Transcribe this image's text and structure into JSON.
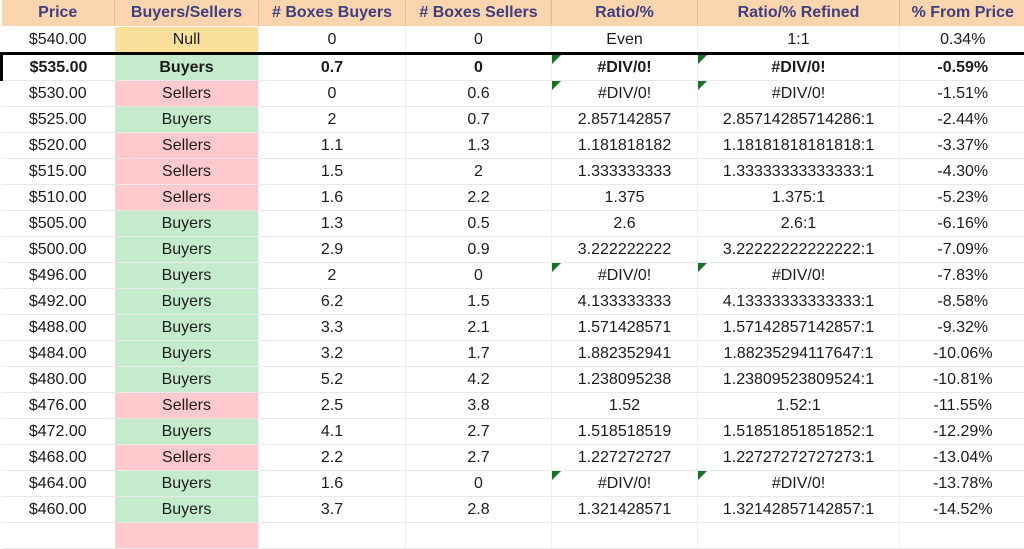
{
  "sheet": {
    "columns": [
      {
        "key": "price",
        "label": "Price"
      },
      {
        "key": "bs",
        "label": "Buyers/Sellers"
      },
      {
        "key": "bb",
        "label": "# Boxes Buyers"
      },
      {
        "key": "bsel",
        "label": "# Boxes Sellers"
      },
      {
        "key": "ratio",
        "label": "Ratio/%"
      },
      {
        "key": "refined",
        "label": "Ratio/% Refined"
      },
      {
        "key": "pct",
        "label": "% From Price"
      }
    ],
    "colors": {
      "header_bg": "#fbd5ae",
      "header_text": "#3f3f7f",
      "buyers_bg": "#c5ebcd",
      "buyers_text": "#1c7a29",
      "sellers_bg": "#ffc9cd",
      "sellers_text": "#c62338",
      "null_bg": "#fbe09b",
      "null_text": "#9a6d1c",
      "error_marker": "#1b7226",
      "selection_border": "#000000"
    },
    "rows": [
      {
        "price": "$540.00",
        "bs": "Null",
        "status": "null",
        "bb": "0",
        "bsel": "0",
        "ratio": "Even",
        "refined": "1:1",
        "pct": "0.34%",
        "ratio_error": false,
        "refined_error": false,
        "selected": false
      },
      {
        "price": "$535.00",
        "bs": "Buyers",
        "status": "buyers",
        "bb": "0.7",
        "bsel": "0",
        "ratio": "#DIV/0!",
        "refined": "#DIV/0!",
        "pct": "-0.59%",
        "ratio_error": true,
        "refined_error": true,
        "selected": true
      },
      {
        "price": "$530.00",
        "bs": "Sellers",
        "status": "sellers",
        "bb": "0",
        "bsel": "0.6",
        "ratio": "#DIV/0!",
        "refined": "#DIV/0!",
        "pct": "-1.51%",
        "ratio_error": true,
        "refined_error": true,
        "selected": false
      },
      {
        "price": "$525.00",
        "bs": "Buyers",
        "status": "buyers",
        "bb": "2",
        "bsel": "0.7",
        "ratio": "2.857142857",
        "refined": "2.85714285714286:1",
        "pct": "-2.44%",
        "ratio_error": false,
        "refined_error": false,
        "selected": false
      },
      {
        "price": "$520.00",
        "bs": "Sellers",
        "status": "sellers",
        "bb": "1.1",
        "bsel": "1.3",
        "ratio": "1.181818182",
        "refined": "1.18181818181818:1",
        "pct": "-3.37%",
        "ratio_error": false,
        "refined_error": false,
        "selected": false
      },
      {
        "price": "$515.00",
        "bs": "Sellers",
        "status": "sellers",
        "bb": "1.5",
        "bsel": "2",
        "ratio": "1.333333333",
        "refined": "1.33333333333333:1",
        "pct": "-4.30%",
        "ratio_error": false,
        "refined_error": false,
        "selected": false
      },
      {
        "price": "$510.00",
        "bs": "Sellers",
        "status": "sellers",
        "bb": "1.6",
        "bsel": "2.2",
        "ratio": "1.375",
        "refined": "1.375:1",
        "pct": "-5.23%",
        "ratio_error": false,
        "refined_error": false,
        "selected": false
      },
      {
        "price": "$505.00",
        "bs": "Buyers",
        "status": "buyers",
        "bb": "1.3",
        "bsel": "0.5",
        "ratio": "2.6",
        "refined": "2.6:1",
        "pct": "-6.16%",
        "ratio_error": false,
        "refined_error": false,
        "selected": false
      },
      {
        "price": "$500.00",
        "bs": "Buyers",
        "status": "buyers",
        "bb": "2.9",
        "bsel": "0.9",
        "ratio": "3.222222222",
        "refined": "3.22222222222222:1",
        "pct": "-7.09%",
        "ratio_error": false,
        "refined_error": false,
        "selected": false
      },
      {
        "price": "$496.00",
        "bs": "Buyers",
        "status": "buyers",
        "bb": "2",
        "bsel": "0",
        "ratio": "#DIV/0!",
        "refined": "#DIV/0!",
        "pct": "-7.83%",
        "ratio_error": true,
        "refined_error": true,
        "selected": false
      },
      {
        "price": "$492.00",
        "bs": "Buyers",
        "status": "buyers",
        "bb": "6.2",
        "bsel": "1.5",
        "ratio": "4.133333333",
        "refined": "4.13333333333333:1",
        "pct": "-8.58%",
        "ratio_error": false,
        "refined_error": false,
        "selected": false
      },
      {
        "price": "$488.00",
        "bs": "Buyers",
        "status": "buyers",
        "bb": "3.3",
        "bsel": "2.1",
        "ratio": "1.571428571",
        "refined": "1.57142857142857:1",
        "pct": "-9.32%",
        "ratio_error": false,
        "refined_error": false,
        "selected": false
      },
      {
        "price": "$484.00",
        "bs": "Buyers",
        "status": "buyers",
        "bb": "3.2",
        "bsel": "1.7",
        "ratio": "1.882352941",
        "refined": "1.88235294117647:1",
        "pct": "-10.06%",
        "ratio_error": false,
        "refined_error": false,
        "selected": false
      },
      {
        "price": "$480.00",
        "bs": "Buyers",
        "status": "buyers",
        "bb": "5.2",
        "bsel": "4.2",
        "ratio": "1.238095238",
        "refined": "1.23809523809524:1",
        "pct": "-10.81%",
        "ratio_error": false,
        "refined_error": false,
        "selected": false
      },
      {
        "price": "$476.00",
        "bs": "Sellers",
        "status": "sellers",
        "bb": "2.5",
        "bsel": "3.8",
        "ratio": "1.52",
        "refined": "1.52:1",
        "pct": "-11.55%",
        "ratio_error": false,
        "refined_error": false,
        "selected": false
      },
      {
        "price": "$472.00",
        "bs": "Buyers",
        "status": "buyers",
        "bb": "4.1",
        "bsel": "2.7",
        "ratio": "1.518518519",
        "refined": "1.51851851851852:1",
        "pct": "-12.29%",
        "ratio_error": false,
        "refined_error": false,
        "selected": false
      },
      {
        "price": "$468.00",
        "bs": "Sellers",
        "status": "sellers",
        "bb": "2.2",
        "bsel": "2.7",
        "ratio": "1.227272727",
        "refined": "1.22727272727273:1",
        "pct": "-13.04%",
        "ratio_error": false,
        "refined_error": false,
        "selected": false
      },
      {
        "price": "$464.00",
        "bs": "Buyers",
        "status": "buyers",
        "bb": "1.6",
        "bsel": "0",
        "ratio": "#DIV/0!",
        "refined": "#DIV/0!",
        "pct": "-13.78%",
        "ratio_error": true,
        "refined_error": true,
        "selected": false
      },
      {
        "price": "$460.00",
        "bs": "Buyers",
        "status": "buyers",
        "bb": "3.7",
        "bsel": "2.8",
        "ratio": "1.321428571",
        "refined": "1.32142857142857:1",
        "pct": "-14.52%",
        "ratio_error": false,
        "refined_error": false,
        "selected": false
      },
      {
        "price": "",
        "bs": "",
        "status": "sellers",
        "bb": "",
        "bsel": "",
        "ratio": "",
        "refined": "",
        "pct": "",
        "ratio_error": false,
        "refined_error": false,
        "selected": false,
        "clipped": true
      }
    ]
  }
}
